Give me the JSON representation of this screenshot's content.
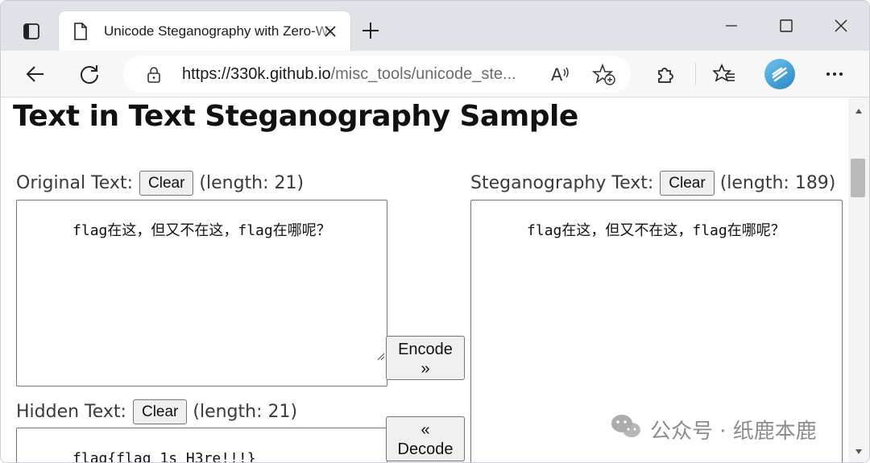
{
  "browser": {
    "tab_title": "Unicode Steganography with Zero-Width Characters",
    "url_host": "https://330k.github.io",
    "url_path": "/misc_tools/unicode_ste...",
    "read_aloud_label": "A͠"
  },
  "page": {
    "title": "Text in Text Steganography Sample",
    "original": {
      "label": "Original Text:",
      "clear_label": "Clear",
      "length_text": "(length: 21)",
      "value": "flag在这，但又不在这，flag在哪呢？"
    },
    "stego": {
      "label": "Steganography Text:",
      "clear_label": "Clear",
      "length_text": "(length: 189)",
      "value": "flag在这，但又不在这，flag在哪呢？"
    },
    "hidden": {
      "label": "Hidden Text:",
      "clear_label": "Clear",
      "length_text": "(length: 21)",
      "value": "flag{flag_1s_H3re!!!}"
    },
    "encode_label_line1": "Encode",
    "encode_label_line2": "»",
    "decode_label_line1": "«",
    "decode_label_line2": "Decode"
  },
  "watermark": {
    "text": "公众号 · 纸鹿本鹿"
  }
}
